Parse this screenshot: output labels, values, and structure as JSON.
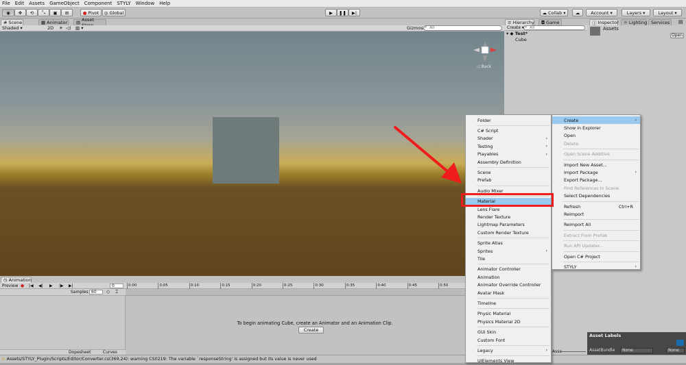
{
  "menubar": [
    "File",
    "Edit",
    "Assets",
    "GameObject",
    "Component",
    "STYLY",
    "Window",
    "Help"
  ],
  "toolbar": {
    "pivot": "Pivot",
    "global": "Global",
    "collab": "Collab",
    "account": "Account",
    "layers": "Layers",
    "layout": "Layout"
  },
  "scene": {
    "tabs": [
      "Scene",
      "Animator",
      "Asset Store"
    ],
    "shading": "Shaded",
    "mode2d": "2D",
    "gizmos": "Gizmos",
    "search_placeholder": "All",
    "back_label": "Back"
  },
  "hierarchy": {
    "tabs": [
      "Hierarchy",
      "Game"
    ],
    "create": "Create",
    "search_placeholder": "All",
    "scene_name": "Test*",
    "items": [
      "Cube"
    ]
  },
  "inspector": {
    "tabs": [
      "Inspector",
      "Lighting",
      "Services"
    ],
    "title": "Assets",
    "open": "Open",
    "asset_labels": "Asset Labels",
    "asset_bundle": "AssetBundle",
    "bundle_values": [
      "None",
      "None"
    ]
  },
  "project": {
    "partial_label": "Asse"
  },
  "animation": {
    "tab": "Animation",
    "preview": "Preview",
    "samples_label": "Samples",
    "samples_value": "60",
    "ticks": [
      "0:00",
      "0:05",
      "0:10",
      "0:15",
      "0:20",
      "0:25",
      "0:30",
      "0:35",
      "0:40",
      "0:45",
      "0:50"
    ],
    "message": "To begin animating Cube, create an Animator and an Animation Clip.",
    "create": "Create",
    "bottom_tabs": [
      "Dopesheet",
      "Curves"
    ]
  },
  "status": {
    "text": "Assets/STYLY_Plugin/Scripts/Editor/Converter.cs(369,24): warning CS0219: The variable `responseString' is assigned but its value is never used"
  },
  "submenu": {
    "items": [
      {
        "label": "Folder"
      },
      {
        "sep": true
      },
      {
        "label": "C# Script"
      },
      {
        "label": "Shader",
        "arrow": true
      },
      {
        "label": "Testing",
        "arrow": true
      },
      {
        "label": "Playables",
        "arrow": true
      },
      {
        "label": "Assembly Definition"
      },
      {
        "sep": true
      },
      {
        "label": "Scene"
      },
      {
        "label": "Prefab"
      },
      {
        "sep": true
      },
      {
        "label": "Audio Mixer"
      },
      {
        "sep": true
      },
      {
        "label": "Material",
        "highlight": true
      },
      {
        "label": "Lens Flare"
      },
      {
        "label": "Render Texture"
      },
      {
        "label": "Lightmap Parameters"
      },
      {
        "label": "Custom Render Texture"
      },
      {
        "sep": true
      },
      {
        "label": "Sprite Atlas"
      },
      {
        "label": "Sprites",
        "arrow": true
      },
      {
        "label": "Tile"
      },
      {
        "sep": true
      },
      {
        "label": "Animator Controller"
      },
      {
        "label": "Animation"
      },
      {
        "label": "Animator Override Controller"
      },
      {
        "label": "Avatar Mask"
      },
      {
        "sep": true
      },
      {
        "label": "Timeline"
      },
      {
        "sep": true
      },
      {
        "label": "Physic Material"
      },
      {
        "label": "Physics Material 2D"
      },
      {
        "sep": true
      },
      {
        "label": "GUI Skin"
      },
      {
        "label": "Custom Font"
      },
      {
        "sep": true
      },
      {
        "label": "Legacy",
        "arrow": true
      },
      {
        "sep": true
      },
      {
        "label": "UIElements View"
      }
    ]
  },
  "context": {
    "items": [
      {
        "label": "Create",
        "arrow": true,
        "highlight": true
      },
      {
        "label": "Show in Explorer"
      },
      {
        "label": "Open"
      },
      {
        "label": "Delete",
        "disabled": true
      },
      {
        "sep": true
      },
      {
        "label": "Open Scene Additive",
        "disabled": true
      },
      {
        "sep": true
      },
      {
        "label": "Import New Asset..."
      },
      {
        "label": "Import Package",
        "arrow": true
      },
      {
        "label": "Export Package..."
      },
      {
        "label": "Find References In Scene",
        "disabled": true
      },
      {
        "label": "Select Dependencies"
      },
      {
        "sep": true
      },
      {
        "label": "Refresh",
        "shortcut": "Ctrl+R"
      },
      {
        "label": "Reimport"
      },
      {
        "sep": true
      },
      {
        "label": "Reimport All"
      },
      {
        "sep": true
      },
      {
        "label": "Extract From Prefab",
        "disabled": true
      },
      {
        "sep": true
      },
      {
        "label": "Run API Updater...",
        "disabled": true
      },
      {
        "sep": true
      },
      {
        "label": "Open C# Project"
      },
      {
        "sep": true
      },
      {
        "label": "STYLY",
        "arrow": true
      }
    ]
  },
  "colors": {
    "menu_highlight": "#99c9ef",
    "annotation_red": "#ee1c1c"
  }
}
